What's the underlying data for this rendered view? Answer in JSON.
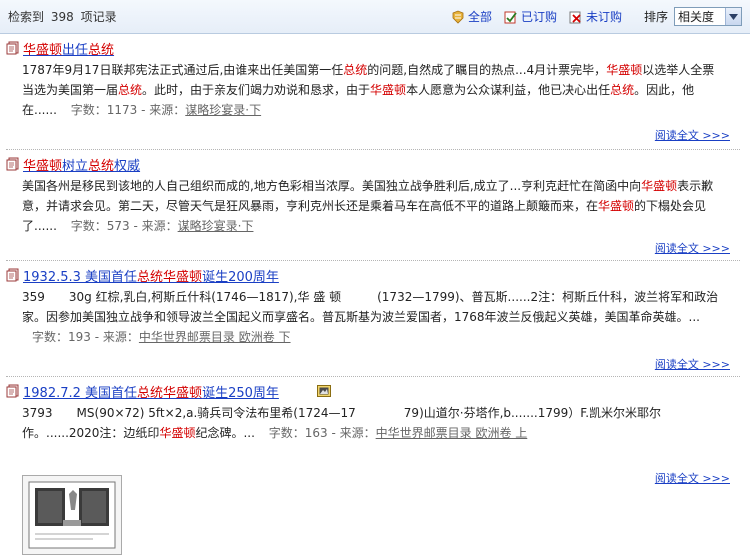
{
  "header": {
    "count_prefix": "检索到",
    "count_value": "398",
    "count_suffix": "项记录",
    "filters": [
      {
        "label": "全部",
        "icon": "all-icon"
      },
      {
        "label": "已订购",
        "icon": "subscribed-icon"
      },
      {
        "label": "未订购",
        "icon": "unsubscribed-icon"
      }
    ],
    "sort_label": "排序",
    "sort_selected": "相关度"
  },
  "results": [
    {
      "title_parts": [
        [
          "华盛顿",
          true
        ],
        [
          "出任",
          false
        ],
        [
          "总统",
          true
        ]
      ],
      "snippet_parts": [
        [
          "1787年9月17日联邦宪法正式通过后,由谁来出任美国第一任",
          false
        ],
        [
          "总统",
          true
        ],
        [
          "的问题,自然成了瞩目的热点...4月计票完毕，",
          false
        ],
        [
          "华盛顿",
          true
        ],
        [
          "以选举人全票当选为美国第一届",
          false
        ],
        [
          "总统",
          true
        ],
        [
          "。此时，由于亲友们竭力劝说和恳求，由于",
          false
        ],
        [
          "华盛顿",
          true
        ],
        [
          "本人愿意为公众谋利益，他已决心出任",
          false
        ],
        [
          "总统",
          true
        ],
        [
          "。因此，他在......",
          false
        ]
      ],
      "word_count_label": "字数：",
      "word_count": "1173",
      "source_label": "- 来源：",
      "source": "谋略珍宴录·下",
      "read_more": "阅读全文 >>>"
    },
    {
      "title_parts": [
        [
          "华盛顿",
          true
        ],
        [
          "树立",
          false
        ],
        [
          "总统",
          true
        ],
        [
          "权威",
          false
        ]
      ],
      "snippet_parts": [
        [
          "美国各州是移民到该地的人自己组织而成的,地方色彩相当浓厚。美国独立战争胜利后,成立了...亨利克赶忙在简函中向",
          false
        ],
        [
          "华盛顿",
          true
        ],
        [
          "表示歉意，并请求会见。第二天，尽管天气是狂风暴雨，亨利克州长还是乘着马车在高低不平的道路上颠簸而来，在",
          false
        ],
        [
          "华盛顿",
          true
        ],
        [
          "的下榻处会见了......",
          false
        ]
      ],
      "word_count_label": "字数：",
      "word_count": "573",
      "source_label": "- 来源：",
      "source": "谋略珍宴录·下",
      "read_more": "阅读全文 >>>"
    },
    {
      "title_parts": [
        [
          "1932.5.3 美国首任",
          false
        ],
        [
          "总统",
          true
        ],
        [
          "华盛顿",
          true
        ],
        [
          "诞生200周年",
          false
        ]
      ],
      "snippet_parts": [
        [
          "359　　30g 红棕,乳白,柯斯丘什科(1746—1817),华 盛 顿　　　(1732—1799)、普瓦斯......2注：柯斯丘什科，波兰将军和政治家。因参加美国独立战争和领导波兰全国起义而享盛名。普瓦斯基为波兰爱国者，1768年波兰反俄起义英雄，美国革命英雄。...",
          false
        ]
      ],
      "word_count_label": "字数：",
      "word_count": "193",
      "source_label": "- 来源：",
      "source": "中华世界邮票目录 欧洲卷 下",
      "read_more": "阅读全文 >>>"
    },
    {
      "title_parts": [
        [
          "1982.7.2 美国首任",
          false
        ],
        [
          "总统",
          true
        ],
        [
          "华盛顿",
          true
        ],
        [
          "诞生250周年",
          false
        ]
      ],
      "snippet_parts": [
        [
          "3793　　MS(90×72) 5ft×2,a.骑兵司令法布里希(1724—17　　　　79)山道尔·芬塔作,b.......1799）F.凯米尔米耶尔作。......2020注：边纸印",
          false
        ],
        [
          "华盛顿",
          true
        ],
        [
          "纪念碑。...",
          false
        ]
      ],
      "word_count_label": "字数：",
      "word_count": "163",
      "source_label": "- 来源：",
      "source": "中华世界邮票目录 欧洲卷 上",
      "read_more": "阅读全文 >>>"
    }
  ]
}
